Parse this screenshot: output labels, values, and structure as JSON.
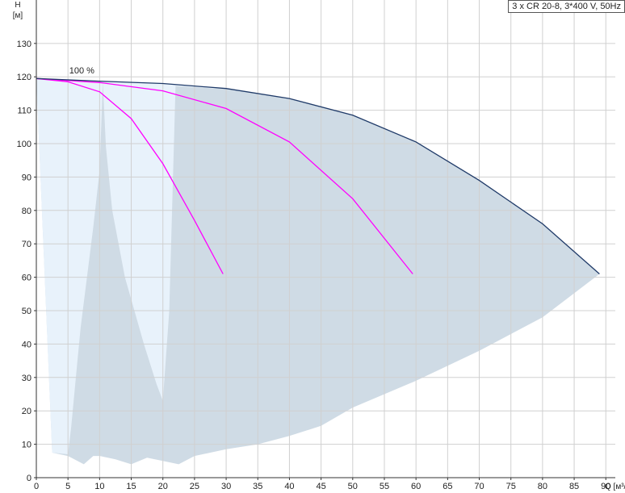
{
  "chart_data": {
    "type": "line",
    "title": "3 x CR 20-8, 3*400 V, 50Hz",
    "xlabel": "Q [м³/ч]",
    "ylabel": "H",
    "ylabel_unit": "[м]",
    "xlim": [
      0,
      91.5
    ],
    "ylim": [
      0,
      143
    ],
    "x_ticks": [
      0,
      5,
      10,
      15,
      20,
      25,
      30,
      35,
      40,
      45,
      50,
      55,
      60,
      65,
      70,
      75,
      80,
      85,
      90
    ],
    "y_ticks": [
      0,
      10,
      20,
      30,
      40,
      50,
      60,
      70,
      80,
      90,
      100,
      110,
      120,
      130
    ],
    "grid": true,
    "legend_placement": "top-right",
    "annotation": "100 %",
    "colors": {
      "envelope_fill": "#cfdbe5",
      "light_fill": "#e8f2fb",
      "envelope_line": "#1f3a68",
      "pump_curve": "#ff00ff",
      "grid": "#d0d0d0"
    },
    "series": [
      {
        "kind": "pump-curve",
        "x": [
          0,
          5,
          10,
          15,
          20,
          25,
          29.5
        ],
        "y": [
          119.5,
          118.5,
          115.5,
          107.5,
          94,
          77,
          61
        ]
      },
      {
        "kind": "pump-curve",
        "x": [
          0,
          10,
          20,
          30,
          40,
          50,
          59.5
        ],
        "y": [
          119.5,
          118.3,
          115.8,
          110.5,
          100.5,
          83.5,
          61
        ]
      },
      {
        "kind": "pump-curve",
        "x": [
          0,
          10,
          20,
          30,
          40,
          50,
          60,
          70,
          80,
          89
        ],
        "y": [
          119.5,
          118.7,
          118,
          116.5,
          113.5,
          108.5,
          100.5,
          89,
          76,
          61
        ]
      }
    ],
    "envelope_lower": {
      "x": [
        89,
        80,
        70,
        60,
        50,
        45,
        40,
        35,
        30,
        25,
        22.5,
        20,
        17.5,
        15,
        12.5,
        10,
        9,
        7.5,
        5,
        2.5
      ],
      "y": [
        61,
        48,
        38,
        29,
        21,
        15.5,
        12.5,
        10,
        8.5,
        6.5,
        4,
        5,
        6,
        4,
        5.5,
        6.5,
        6.5,
        4,
        6.5,
        7.5
      ]
    },
    "light_regions": [
      {
        "x": [
          0,
          10.5,
          11,
          12,
          14,
          17,
          19,
          20,
          21,
          22,
          24,
          26,
          28,
          30,
          32,
          30,
          25,
          20,
          15,
          10,
          5,
          0
        ],
        "y": [
          119.5,
          118.4,
          99,
          80,
          60,
          40,
          28,
          23,
          50,
          117.3,
          117,
          116.8,
          116.5,
          116.5,
          116.3,
          116.5,
          117.3,
          118,
          118.4,
          118.7,
          119,
          119.5
        ]
      },
      {
        "x": [
          0,
          2.5,
          5,
          5.5,
          6,
          6.5,
          7,
          8,
          9,
          10,
          10.5,
          5,
          0
        ],
        "y": [
          119.5,
          7.5,
          7,
          15,
          25,
          35,
          45,
          60,
          75,
          92,
          118.4,
          119,
          119.5
        ]
      }
    ]
  }
}
